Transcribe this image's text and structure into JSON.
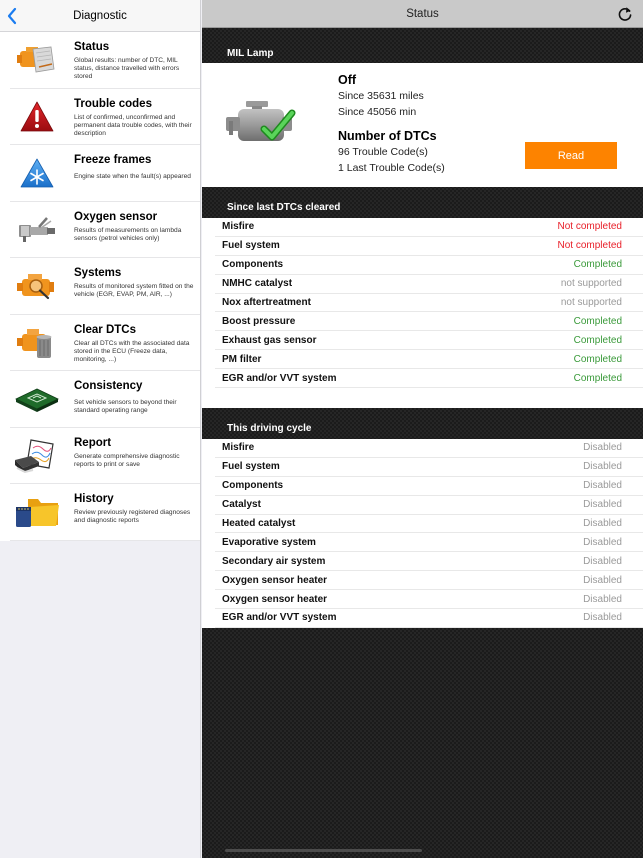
{
  "sidebar": {
    "title": "Diagnostic",
    "back_icon": "chevron-left-icon",
    "items": [
      {
        "id": "status",
        "label": "Status",
        "description": "Global results: number of DTC, MIL status, distance travelled with errors stored",
        "icon": "engine-document-icon"
      },
      {
        "id": "trouble-codes",
        "label": "Trouble codes",
        "description": "List of confirmed, unconfirmed and permanent data trouble codes, with their description",
        "icon": "warning-triangle-icon"
      },
      {
        "id": "freeze-frames",
        "label": "Freeze frames",
        "description": "Engine state when the fault(s) appeared",
        "icon": "snowflake-triangle-icon"
      },
      {
        "id": "oxygen-sensor",
        "label": "Oxygen sensor",
        "description": "Results of measurements on lambda sensors (petrol vehicles only)",
        "icon": "oxygen-sensor-icon"
      },
      {
        "id": "systems",
        "label": "Systems",
        "description": "Results of monitored system fitted on the vehicle (EGR, EVAP, PM, AIR, ...)",
        "icon": "engine-magnifier-icon"
      },
      {
        "id": "clear-dtcs",
        "label": "Clear DTCs",
        "description": "Clear all DTCs with the associated data stored in the ECU (Freeze data, monitoring, ...)",
        "icon": "engine-trash-icon"
      },
      {
        "id": "consistency",
        "label": "Consistency",
        "description": "Set vehicle sensors to beyond their standard operating range",
        "icon": "circuit-board-icon"
      },
      {
        "id": "report",
        "label": "Report",
        "description": "Generate comprehensive diagnostic reports to print or save",
        "icon": "printer-report-icon"
      },
      {
        "id": "history",
        "label": "History",
        "description": "Review previously registered diagnoses and diagnostic reports",
        "icon": "folder-card-icon"
      }
    ]
  },
  "main": {
    "title": "Status",
    "refresh_icon": "refresh-icon",
    "mil": {
      "section_title": "MIL Lamp",
      "state": "Off",
      "since_distance": "Since 35631 miles",
      "since_time": "Since 45056 min",
      "dtc_heading": "Number of DTCs",
      "trouble_codes": "96 Trouble Code(s)",
      "last_trouble_codes": "1 Last Trouble Code(s)",
      "read_button": "Read",
      "icon": "engine-check-icon"
    },
    "since_cleared": {
      "section_title": "Since last DTCs cleared",
      "rows": [
        {
          "label": "Misfire",
          "value": "Not completed",
          "status": "bad"
        },
        {
          "label": "Fuel system",
          "value": "Not completed",
          "status": "bad"
        },
        {
          "label": "Components",
          "value": "Completed",
          "status": "ok"
        },
        {
          "label": "NMHC catalyst",
          "value": "not supported",
          "status": "na"
        },
        {
          "label": "Nox aftertreatment",
          "value": "not supported",
          "status": "na"
        },
        {
          "label": "Boost pressure",
          "value": "Completed",
          "status": "ok"
        },
        {
          "label": "Exhaust gas sensor",
          "value": "Completed",
          "status": "ok"
        },
        {
          "label": "PM filter",
          "value": "Completed",
          "status": "ok"
        },
        {
          "label": "EGR and/or VVT system",
          "value": "Completed",
          "status": "ok"
        }
      ]
    },
    "driving_cycle": {
      "section_title": "This driving cycle",
      "rows": [
        {
          "label": "Misfire",
          "value": "Disabled",
          "status": "na"
        },
        {
          "label": "Fuel system",
          "value": "Disabled",
          "status": "na"
        },
        {
          "label": "Components",
          "value": "Disabled",
          "status": "na"
        },
        {
          "label": "Catalyst",
          "value": "Disabled",
          "status": "na"
        },
        {
          "label": "Heated catalyst",
          "value": "Disabled",
          "status": "na"
        },
        {
          "label": "Evaporative system",
          "value": "Disabled",
          "status": "na"
        },
        {
          "label": "Secondary air system",
          "value": "Disabled",
          "status": "na"
        },
        {
          "label": "Oxygen sensor heater",
          "value": "Disabled",
          "status": "na"
        },
        {
          "label": "Oxygen sensor heater",
          "value": "Disabled",
          "status": "na"
        },
        {
          "label": "EGR and/or VVT system",
          "value": "Disabled",
          "status": "na"
        }
      ]
    }
  },
  "colors": {
    "accent": "#fd8300",
    "status_bad": "#e8202a",
    "status_ok": "#3a9a3a",
    "status_na": "#9a9a9a",
    "ios_blue": "#1a7cf0"
  }
}
